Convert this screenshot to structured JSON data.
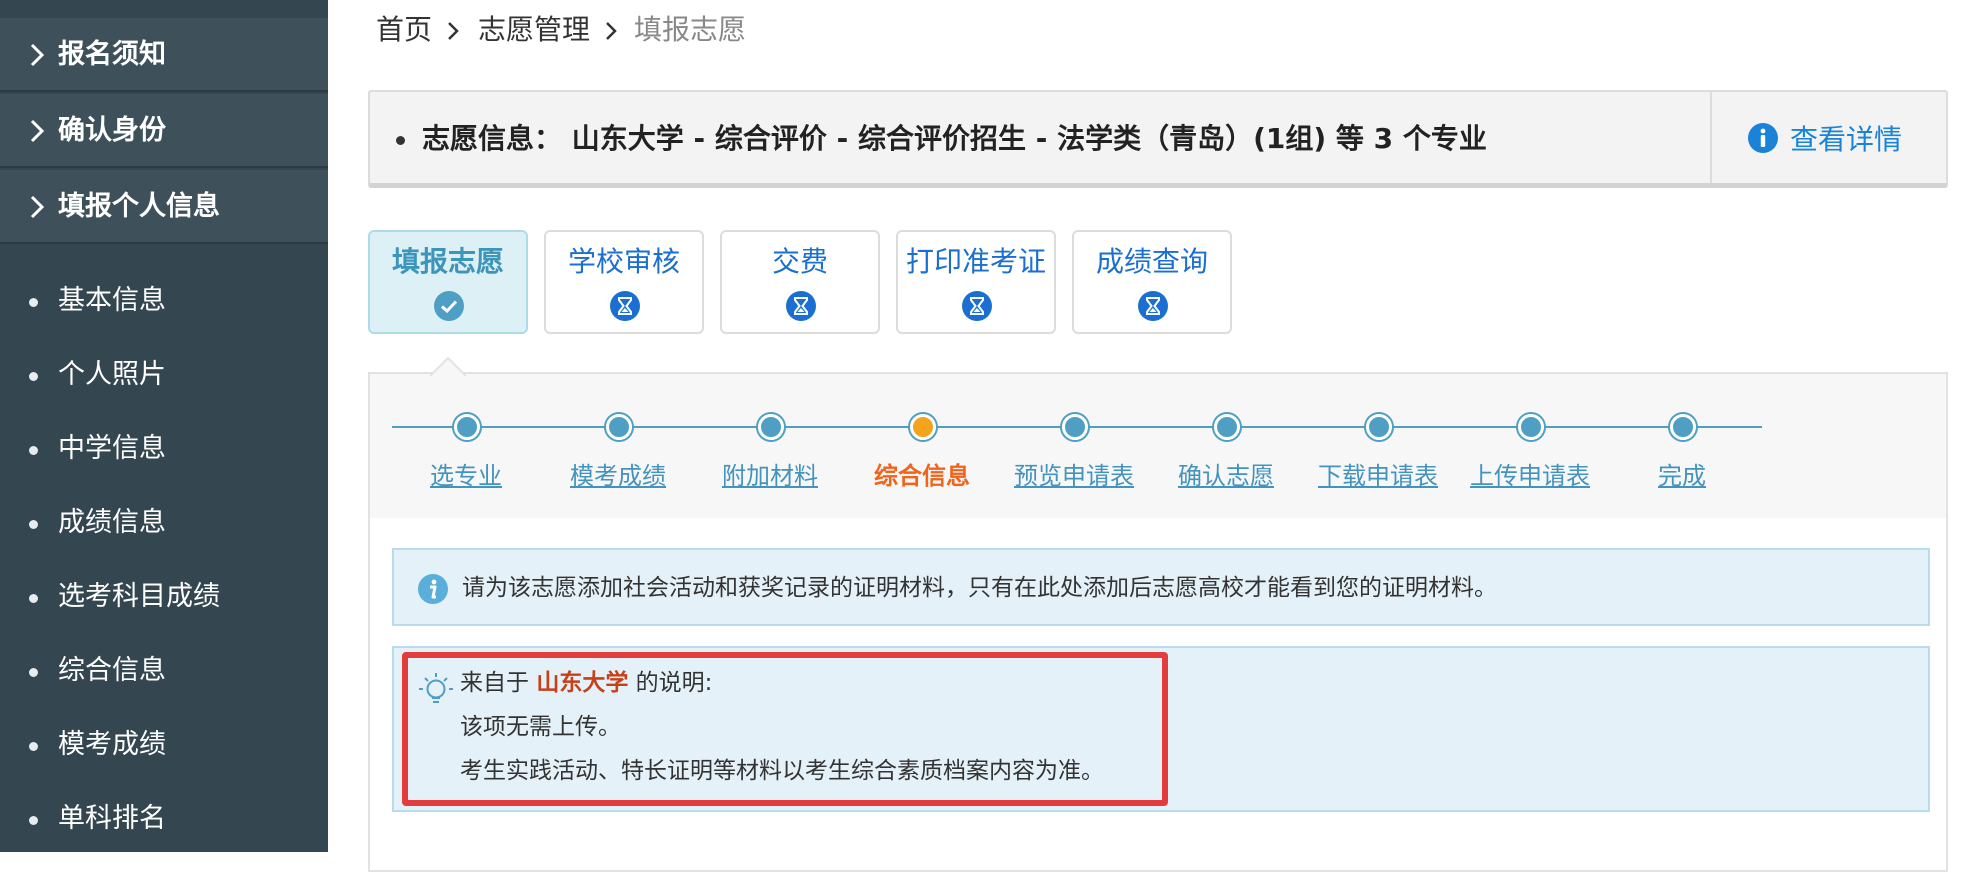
{
  "sidebar": {
    "sections": [
      {
        "label": "报名须知"
      },
      {
        "label": "确认身份"
      },
      {
        "label": "填报个人信息"
      }
    ],
    "sub_items": [
      {
        "label": "基本信息"
      },
      {
        "label": "个人照片"
      },
      {
        "label": "中学信息"
      },
      {
        "label": "成绩信息"
      },
      {
        "label": "选考科目成绩"
      },
      {
        "label": "综合信息"
      },
      {
        "label": "模考成绩"
      },
      {
        "label": "单科排名"
      }
    ]
  },
  "breadcrumb": {
    "items": [
      "首页",
      "志愿管理",
      "填报志愿"
    ]
  },
  "info_bar": {
    "text": "志愿信息： 山东大学 - 综合评价 - 综合评价招生 - 法学类（青岛）(1组) 等 3 个专业",
    "detail_label": "查看详情"
  },
  "tabs": [
    {
      "label": "填报志愿",
      "status": "done"
    },
    {
      "label": "学校审核",
      "status": "pending"
    },
    {
      "label": "交费",
      "status": "pending"
    },
    {
      "label": "打印准考证",
      "status": "pending"
    },
    {
      "label": "成绩查询",
      "status": "pending"
    }
  ],
  "steps": {
    "current_index": 3,
    "items": [
      "选专业",
      "模考成绩",
      "附加材料",
      "综合信息",
      "预览申请表",
      "确认志愿",
      "下载申请表",
      "上传申请表",
      "完成"
    ]
  },
  "notice": {
    "text": "请为该志愿添加社会活动和获奖记录的证明材料，只有在此处添加后志愿高校才能看到您的证明材料。"
  },
  "explanation": {
    "prefix": "来自于",
    "school": "山东大学",
    "suffix": "的说明:",
    "lines": [
      "该项无需上传。",
      "考生实践活动、特长证明等材料以考生综合素质档案内容为准。"
    ]
  },
  "colors": {
    "sidebar_bg": "#344650",
    "accent_blue": "#4f9fc4",
    "link_blue": "#1a83d8",
    "current_step": "#f0641c",
    "highlight_red": "#e23c3c"
  },
  "icons": {
    "section_chevron": "chevron-right-icon",
    "sub_bullet": "dot-icon",
    "info": "info-icon",
    "done": "check-circle-icon",
    "pending": "hourglass-icon",
    "tip": "lightbulb-icon"
  }
}
